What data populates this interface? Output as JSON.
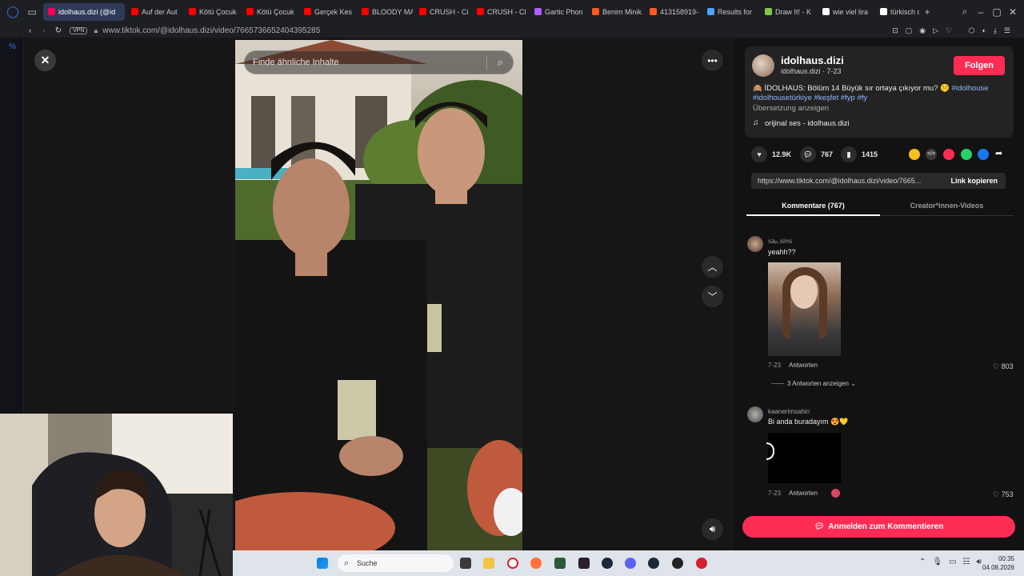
{
  "browser": {
    "tabs": [
      {
        "label": "idolhaus.dizi (@id",
        "color": "#ff0050",
        "active": true
      },
      {
        "label": "Auf der Aut",
        "color": "#ff0000"
      },
      {
        "label": "Kötü Çocuk",
        "color": "#ff0000"
      },
      {
        "label": "Kötü Çocuk",
        "color": "#ff0000"
      },
      {
        "label": "Gerçek Kes",
        "color": "#ff0000"
      },
      {
        "label": "BLOODY MA",
        "color": "#ff0000"
      },
      {
        "label": "CRUSH - Ci",
        "color": "#ff0000"
      },
      {
        "label": "CRUSH - Cl",
        "color": "#ff0000"
      },
      {
        "label": "Gartic Phon",
        "color": "#b05cff"
      },
      {
        "label": "Benim Minik",
        "color": "#ff5a1f"
      },
      {
        "label": "413158919-",
        "color": "#ff5a1f"
      },
      {
        "label": "Results for",
        "color": "#4aa3ff"
      },
      {
        "label": "Draw It! - K",
        "color": "#7ec850"
      },
      {
        "label": "wie viel lira",
        "color": "#ffffff"
      },
      {
        "label": "türkisch deu",
        "color": "#ffffff"
      }
    ],
    "new_tab": "+",
    "vpn": "VPN",
    "url": "www.tiktok.com/@idolhaus.dizi/video/7665736652404395285"
  },
  "video": {
    "search_placeholder": "Finde ähnliche Inhalte"
  },
  "post": {
    "display_name": "idolhaus.dizi",
    "handle_date": "idolhaus.dizi · 7-23",
    "follow_label": "Folgen",
    "caption_prefix": "🙈 İDOLHAUS: Bölüm 14 Büyük sır ortaya çıkıyor mu? 🤫 ",
    "hashtag1": "#idolhouse",
    "hashtags_line2": "#idolhousetürkiye #keşfet #fyp #fy",
    "translate": "Übersetzung anzeigen",
    "sound": "orijinal ses - idolhaus.dizi",
    "likes": "12.9K",
    "comments": "767",
    "saves": "1415",
    "link": "https://www.tiktok.com/@idolhaus.dizi/video/7665...",
    "copy_link": "Link kopieren",
    "tab_comments": "Kommentare (767)",
    "tab_creator": "Creator*innen-Videos"
  },
  "comments": [
    {
      "user": "𝗌𝖺ₚ.𝗌𝗂𝗇𝗌",
      "text": "yeahh??",
      "date": "7-23",
      "reply": "Antworten",
      "likes": "803",
      "more_replies": "3 Antworten anzeigen"
    },
    {
      "user": "kaanerimsahin",
      "text": "Bi anda buradayım 😍💛",
      "date": "7-23",
      "reply": "Antworten",
      "likes": "753"
    }
  ],
  "login_button": "Anmelden zum Kommentieren",
  "taskbar": {
    "search": "Suche",
    "time": "00:35",
    "date": "04.08.2026"
  }
}
